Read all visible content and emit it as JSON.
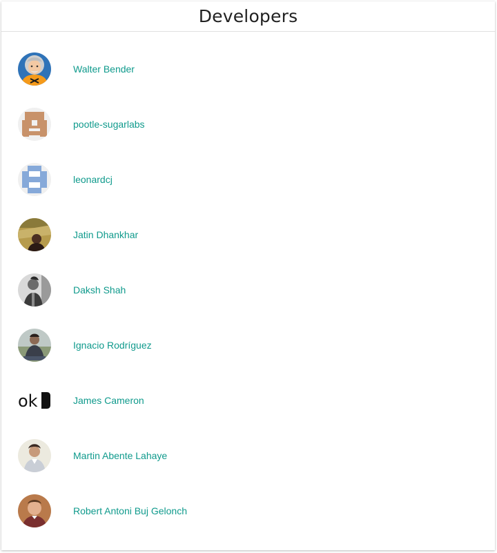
{
  "page": {
    "title": "Developers"
  },
  "colors": {
    "link": "#0f9a8c",
    "title": "#212121",
    "divider": "#e0e0e0"
  },
  "developers": [
    {
      "name": "Walter Bender",
      "avatar_icon": "cartoon-avatar-icon"
    },
    {
      "name": "pootle-sugarlabs",
      "avatar_icon": "identicon-brown-icon"
    },
    {
      "name": "leonardcj",
      "avatar_icon": "identicon-blue-icon"
    },
    {
      "name": "Jatin Dhankhar",
      "avatar_icon": "photo-avatar-icon"
    },
    {
      "name": "Daksh Shah",
      "avatar_icon": "photo-avatar-icon"
    },
    {
      "name": "Ignacio Rodríguez",
      "avatar_icon": "photo-avatar-icon"
    },
    {
      "name": "James Cameron",
      "avatar_icon": "ok-text-avatar-icon",
      "avatar_text": "ok"
    },
    {
      "name": "Martin Abente Lahaye",
      "avatar_icon": "photo-avatar-icon"
    },
    {
      "name": "Robert Antoni Buj Gelonch",
      "avatar_icon": "photo-avatar-icon"
    }
  ]
}
